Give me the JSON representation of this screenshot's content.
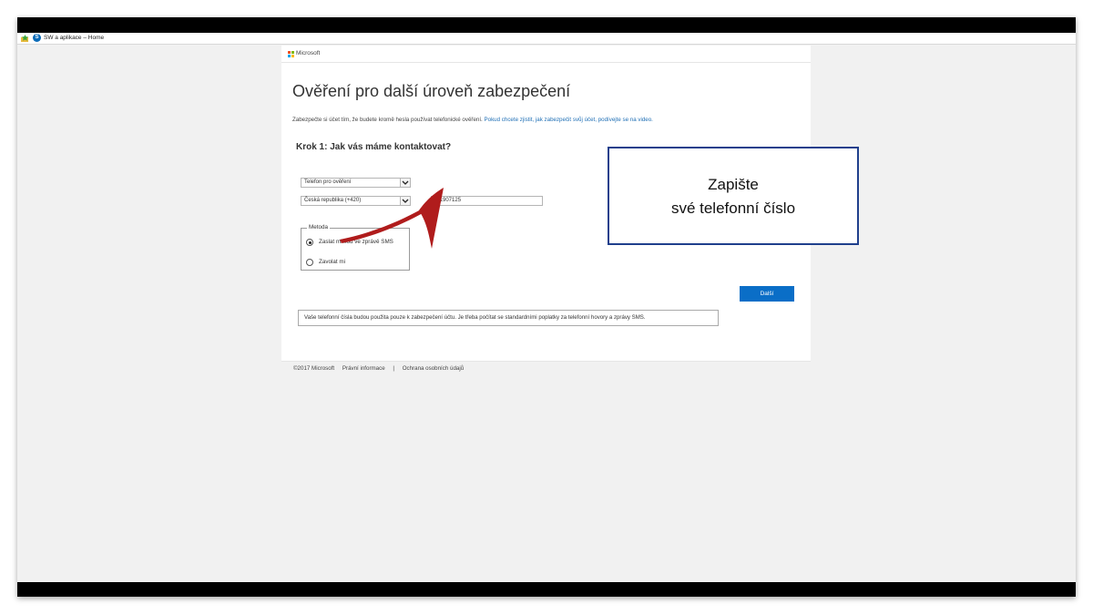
{
  "favorites_bar": {
    "star_icon": "favorites-star-icon",
    "site_icon": "sharepoint-icon",
    "site_icon_letter": "S",
    "link_label": "SW a aplikace – Home"
  },
  "ms_header": {
    "brand": "Microsoft"
  },
  "page": {
    "title": "Ověření pro další úroveň zabezpečení",
    "intro_text": "Zabezpečte si účet tím, že budete kromě hesla používat telefonické ověření.",
    "intro_link": "Pokud chcete zjistit, jak zabezpečit svůj účet, podívejte se na video.",
    "step_title": "Krok 1: Jak vás máme kontaktovat?",
    "phone_type_select": "Telefon pro ověření",
    "country_select": "Česká republika (+420)",
    "phone_number": "731907125",
    "method_legend": "Metoda",
    "method_options": [
      {
        "label": "Zaslat mi kód ve zprávě SMS",
        "selected": true
      },
      {
        "label": "Zavolat mi",
        "selected": false
      }
    ],
    "next_button": "Další",
    "note": "Vaše telefonní čísla budou použita pouze k zabezpečení účtu. Je třeba počítat se standardními poplatky za telefonní hovory a zprávy SMS."
  },
  "footer": {
    "copyright": "©2017 Microsoft",
    "legal_link": "Právní informace",
    "separator": "|",
    "privacy_link": "Ochrana osobních údajů"
  },
  "callout": {
    "line1": "Zapište",
    "line2": "své telefonní číslo"
  },
  "colors": {
    "primary_button": "#0a6ec7",
    "link": "#1f6fb5",
    "callout_border": "#1f3f8c",
    "arrow": "#b01c1c"
  }
}
